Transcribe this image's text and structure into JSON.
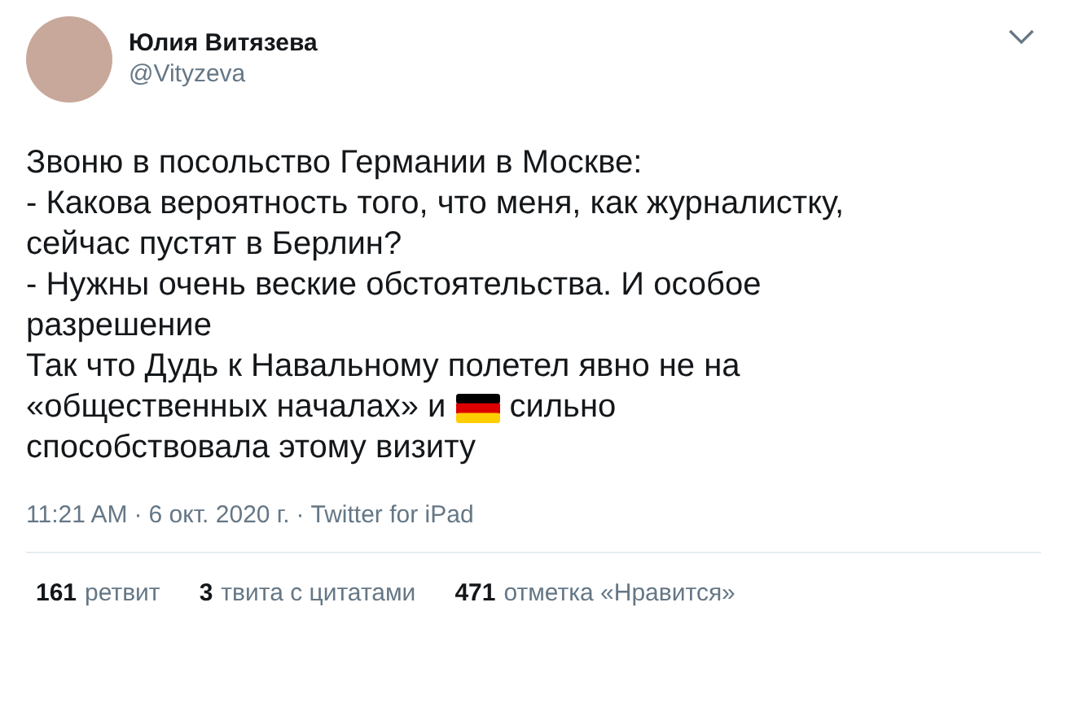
{
  "author": {
    "name": "Юлия Витязева",
    "handle": "@Vityzeva"
  },
  "body": {
    "paragraphs": [
      "Звоню в посольство Германии в Москве:",
      "- Какова вероятность того, что меня, как журналистку, сейчас пустят в Берлин?",
      "- Нужны очень веские обстоятельства. И особое разрешение"
    ],
    "closing": {
      "first": "Так что Дудь к Навальному полетел явно не на",
      "before": "«общественных началах» и",
      "after": "сильно",
      "last": "способствовала этому визиту"
    }
  },
  "meta": {
    "time": "11:21 AM",
    "date": "6 окт. 2020 г.",
    "source": "Twitter for iPad",
    "separator": "·"
  },
  "stats": [
    {
      "count": "161",
      "label": "ретвит"
    },
    {
      "count": "3",
      "label": "твита с цитатами"
    },
    {
      "count": "471",
      "label": "отметка «Нравится»"
    }
  ]
}
